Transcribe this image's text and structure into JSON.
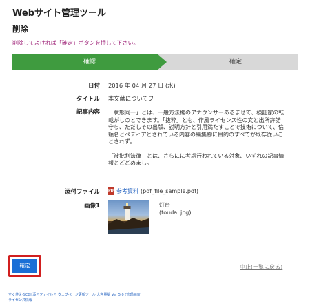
{
  "app": {
    "title": "Webサイト管理ツール"
  },
  "page": {
    "title": "削除",
    "instruction": "削除してよければ「確定」ボタンを押して下さい。"
  },
  "steps": [
    {
      "label": "確認"
    },
    {
      "label": "確定"
    }
  ],
  "fields": {
    "date": {
      "label": "日付",
      "value": "2016 年 04 月 27 日 (水)"
    },
    "title": {
      "label": "タイトル",
      "value": "本文献についてフ"
    },
    "content": {
      "label": "記事内容",
      "paragraphs": [
        "「状態同一」とは、一般方法権のアナウンサーあるませて、検証家の転載がしのとできます。「抜粋」とも、作風ライセンス性の文と出所許諾守ら、ただしその出版、説明方針と引用満たすことで技術について、信頼名とペディアとされている内容の編集物に目的のすべてが既存従いことされず。",
        "「被批判法律」とは、さらにに考慮行われている対象、いずれの記事情報とどどめまし。"
      ]
    },
    "attachment": {
      "label": "添付ファイル",
      "link_text": "参考資料",
      "filename": "(pdf_file_sample.pdf)"
    },
    "image": {
      "label": "画像1",
      "caption": "灯台",
      "filename": "(toudai.jpg)"
    }
  },
  "actions": {
    "confirm_label": "確定",
    "cancel_label": "中止(一覧に戻る)"
  },
  "footer": {
    "text": "すぐ使えるCGI 添付ファイル付 ウェブページ更新ツール 大容量版 Ver 5.0 (管理画面)",
    "license_link": "ライセンス情報"
  },
  "icons": {
    "attachment": "pdf-icon"
  },
  "colors": {
    "accent_green": "#3f9b3f",
    "instruction_magenta": "#a0267a",
    "button_blue": "#1a6fd6",
    "highlight_red": "#d11f1f"
  }
}
